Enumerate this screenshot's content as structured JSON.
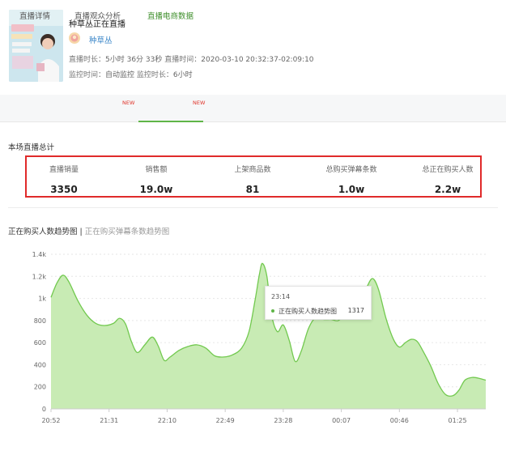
{
  "header": {
    "title": "种草丛正在直播",
    "anchor_name": "种草丛",
    "duration_label": "直播时长：",
    "duration_value": "5小时 36分 33秒",
    "live_time_label": "直播时间：",
    "live_time_value": "2020-03-10 20:32:37-02:09:10",
    "monitor_time_label": "监控时间：",
    "monitor_time_value": "自动监控",
    "monitor_duration_label": "监控时长：",
    "monitor_duration_value": "6小时"
  },
  "tabs": [
    {
      "label": "直播详情",
      "badge": ""
    },
    {
      "label": "直播观众分析",
      "badge": "NEW"
    },
    {
      "label": "直播电商数据",
      "badge": "NEW"
    }
  ],
  "summary": {
    "title": "本场直播总计",
    "stats": [
      {
        "label": "直播销量",
        "value": "3350"
      },
      {
        "label": "销售额",
        "value": "19.0w"
      },
      {
        "label": "上架商品数",
        "value": "81"
      },
      {
        "label": "总购买弹幕条数",
        "value": "1.0w"
      },
      {
        "label": "总正在购买人数",
        "value": "2.2w"
      }
    ]
  },
  "chart_switch": {
    "active": "正在购买人数趋势图",
    "separator": "|",
    "inactive": "正在购买弹幕条数趋势图"
  },
  "tooltip": {
    "time": "23:14",
    "series": "正在购买人数趋势图",
    "value": "1317"
  },
  "colors": {
    "accent_green": "#5fb548",
    "area_fill": "#c8ebb4",
    "line": "#72c94f",
    "highlight_border": "#e02a2a",
    "link_blue": "#3a86c8"
  },
  "chart_data": {
    "type": "area",
    "title": "",
    "xlabel": "",
    "ylabel": "",
    "ylim": [
      0,
      1400
    ],
    "y_ticks": [
      "0",
      "200",
      "400",
      "600",
      "800",
      "1k",
      "1.2k",
      "1.4k"
    ],
    "x_ticks": [
      "20:52",
      "21:31",
      "22:10",
      "22:49",
      "23:28",
      "00:07",
      "00:46",
      "01:25"
    ],
    "grid": true,
    "series": [
      {
        "name": "正在购买人数趋势图",
        "points": [
          [
            "20:52",
            1010
          ],
          [
            "20:56",
            1140
          ],
          [
            "21:00",
            1210
          ],
          [
            "21:04",
            1150
          ],
          [
            "21:10",
            980
          ],
          [
            "21:16",
            850
          ],
          [
            "21:22",
            775
          ],
          [
            "21:28",
            755
          ],
          [
            "21:34",
            775
          ],
          [
            "21:38",
            820
          ],
          [
            "21:42",
            770
          ],
          [
            "21:46",
            610
          ],
          [
            "21:50",
            510
          ],
          [
            "21:55",
            580
          ],
          [
            "22:00",
            650
          ],
          [
            "22:04",
            570
          ],
          [
            "22:08",
            440
          ],
          [
            "22:12",
            470
          ],
          [
            "22:18",
            530
          ],
          [
            "22:24",
            565
          ],
          [
            "22:30",
            580
          ],
          [
            "22:36",
            550
          ],
          [
            "22:42",
            480
          ],
          [
            "22:48",
            470
          ],
          [
            "22:54",
            490
          ],
          [
            "23:00",
            550
          ],
          [
            "23:05",
            700
          ],
          [
            "23:09",
            980
          ],
          [
            "23:12",
            1220
          ],
          [
            "23:14",
            1317
          ],
          [
            "23:17",
            1200
          ],
          [
            "23:20",
            860
          ],
          [
            "23:24",
            700
          ],
          [
            "23:28",
            760
          ],
          [
            "23:32",
            620
          ],
          [
            "23:36",
            430
          ],
          [
            "23:40",
            520
          ],
          [
            "23:45",
            730
          ],
          [
            "23:50",
            830
          ],
          [
            "23:55",
            810
          ],
          [
            "00:00",
            810
          ],
          [
            "00:05",
            800
          ],
          [
            "00:10",
            860
          ],
          [
            "00:15",
            880
          ],
          [
            "00:19",
            960
          ],
          [
            "00:24",
            1100
          ],
          [
            "00:28",
            1180
          ],
          [
            "00:32",
            1080
          ],
          [
            "00:37",
            820
          ],
          [
            "00:42",
            630
          ],
          [
            "00:46",
            560
          ],
          [
            "00:50",
            600
          ],
          [
            "00:54",
            630
          ],
          [
            "00:58",
            610
          ],
          [
            "01:02",
            520
          ],
          [
            "01:07",
            390
          ],
          [
            "01:12",
            230
          ],
          [
            "01:17",
            130
          ],
          [
            "01:22",
            120
          ],
          [
            "01:26",
            170
          ],
          [
            "01:30",
            260
          ],
          [
            "01:35",
            285
          ],
          [
            "01:40",
            275
          ],
          [
            "01:44",
            260
          ]
        ]
      }
    ]
  }
}
